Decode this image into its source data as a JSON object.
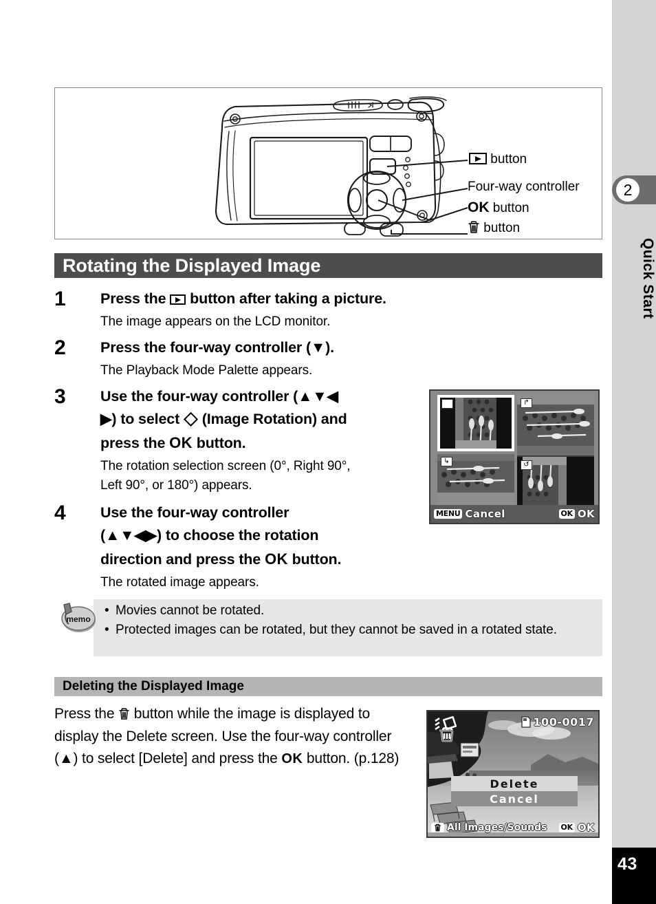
{
  "sidebar": {
    "chapter_number": "2",
    "chapter_title": "Quick Start",
    "page_number": "43"
  },
  "illustration": {
    "callouts": [
      {
        "id": "playback-button",
        "icon": "playback-icon",
        "label": "button"
      },
      {
        "id": "four-way-controller",
        "icon": "",
        "label": "Four-way controller"
      },
      {
        "id": "ok-button",
        "icon": "OK",
        "label": "button"
      },
      {
        "id": "delete-button",
        "icon": "trash-icon",
        "label": "button"
      }
    ]
  },
  "section": {
    "heading": "Rotating the Displayed Image",
    "steps": [
      {
        "number": "1",
        "title_pre": "Press the",
        "title_post": "button after taking a picture.",
        "desc": "The image appears on the LCD monitor."
      },
      {
        "number": "2",
        "title_pre": "Press the four-way controller (▼).",
        "title_post": "",
        "desc": "The Playback Mode Palette appears."
      },
      {
        "number": "3",
        "title_line1": "Use the four-way controller (▲▼◀",
        "title_line2_pre": "▶) to select",
        "title_line2_post": "(Image Rotation) and",
        "title_line3_pre": "press the",
        "title_line3_ok": "OK",
        "title_line3_post": "button.",
        "desc_line1": "The rotation selection screen (0°, Right 90°,",
        "desc_line2": "Left 90°, or 180°) appears."
      },
      {
        "number": "4",
        "title_line1": "Use the four-way controller",
        "title_line2": "(▲▼◀▶) to choose the rotation",
        "title_line3_pre": "direction and press the",
        "title_line3_ok": "OK",
        "title_line3_post": "button.",
        "desc": "The rotated image appears."
      }
    ]
  },
  "memo": {
    "icon_label": "memo",
    "bullets": [
      "Movies cannot be rotated.",
      "Protected images can be rotated, but they cannot be saved in a rotated state."
    ]
  },
  "subsection": {
    "heading": "Deleting the Displayed Image",
    "paragraph_part1": "Press the",
    "paragraph_part2": "button while the image is displayed to display the Delete screen. Use the four-way controller (▲) to select [Delete] and press the",
    "paragraph_ok": "OK",
    "paragraph_part3": "button. (p.128)"
  },
  "rotation_screen": {
    "thumbnails": [
      {
        "id": "rotation-0",
        "icon": "",
        "selected": true
      },
      {
        "id": "rotation-right-90",
        "icon": "↱",
        "selected": false
      },
      {
        "id": "rotation-left-90",
        "icon": "↳",
        "selected": false
      },
      {
        "id": "rotation-180",
        "icon": "↺",
        "selected": false
      }
    ],
    "left_badge": "MENU",
    "left_label": "Cancel",
    "right_badge": "OK",
    "right_label": "OK"
  },
  "delete_screen": {
    "file_number": "100-0017",
    "menu_items": [
      "Delete",
      "Cancel"
    ],
    "bottom_badge": "trash-icon",
    "bottom_label": "All Images/Sounds",
    "right_badge": "OK",
    "right_label": "OK"
  }
}
